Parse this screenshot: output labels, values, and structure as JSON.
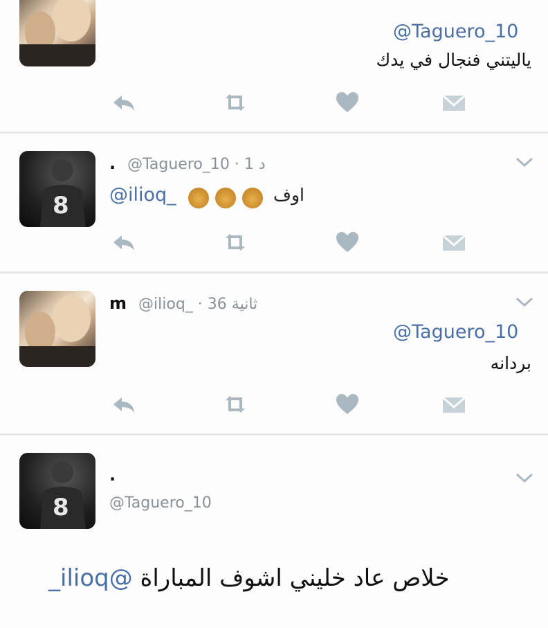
{
  "tweets": [
    {
      "avatar": "photo-avatar",
      "reply_to": "@Taguero_10",
      "text": "ياليتني فنجال في يدك"
    },
    {
      "avatar": "player-avatar",
      "name": ".",
      "handle": "@Taguero_10",
      "time": "1 د",
      "mention": "@ilioq_",
      "text": "اوف",
      "emoji_count": 3,
      "emoji_icon": "see-no-evil-monkey-icon"
    },
    {
      "avatar": "photo-avatar",
      "name": "m",
      "handle": "@ilioq_",
      "time": "36 ثانية",
      "reply_to": "@Taguero_10",
      "text": "بردانه"
    },
    {
      "avatar": "player-avatar",
      "name": ".",
      "handle": "@Taguero_10",
      "mention": "@ilioq_",
      "text": "خلاص عاد خليني اشوف المباراة"
    }
  ],
  "colors": {
    "link": "#4a6fa5",
    "icon": "#aab8c2",
    "divider": "#e6e8ea"
  },
  "icons": [
    "reply-icon",
    "retweet-icon",
    "like-icon",
    "dm-icon",
    "chevron-down-icon"
  ]
}
